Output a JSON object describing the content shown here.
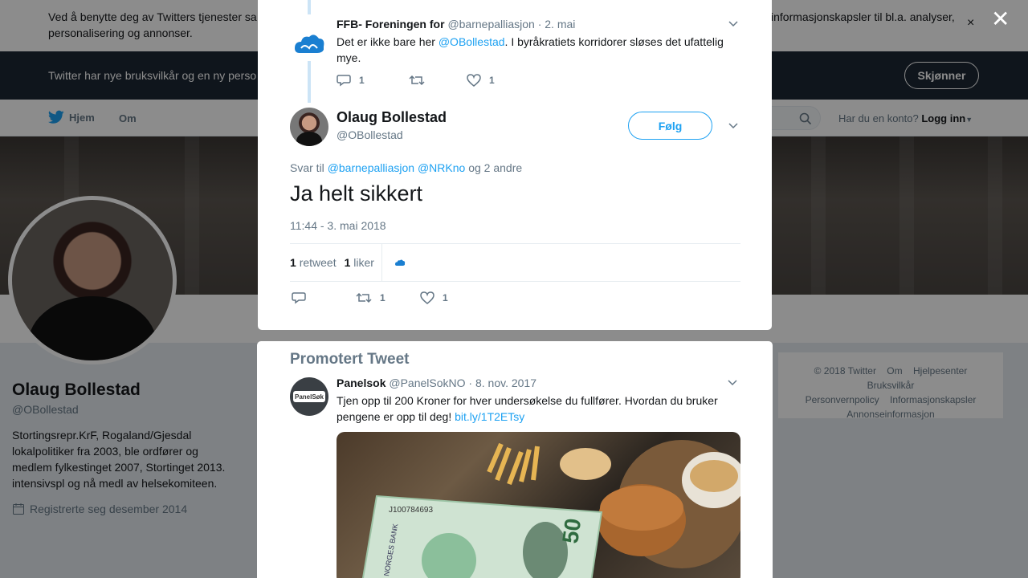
{
  "cookie_bar": {
    "text": "Ved å benytte deg av Twitters tjenester samtykker du i bruken av informasjonskapsler. Twitter og partnere bruker informasjonskapsler til bl.a. analyser, personalisering og annonser.",
    "text_visible_left": "Ved å benytte deg av Twitters tjenester sa",
    "text_visible_right": "informasjonskapsler til bl.a. analyser,",
    "text_line2": "personalisering og annonser.",
    "close": "×"
  },
  "terms_bar": {
    "text": "Twitter har nye bruksvilkår og en ny person",
    "button": "Skjønner"
  },
  "nav": {
    "home": "Hjem",
    "about": "Om",
    "account_prompt": "Har du en konto?",
    "login": "Logg inn"
  },
  "profile": {
    "name": "Olaug Bollestad",
    "handle": "@OBollestad",
    "bio": "Stortingsrepr.KrF, Rogaland/Gjesdal lokalpolitiker fra 2003, ble ordfører og medlem fylkestinget 2007, Stortinget 2013. intensivspl og nå medl av helsekomiteen.",
    "joined": "Registrerte seg desember 2014"
  },
  "footer": {
    "links": [
      "© 2018 Twitter",
      "Om",
      "Hjelpesenter",
      "Bruksvilkår",
      "Personvernpolicy",
      "Informasjonskapsler",
      "Annonseinformasjon"
    ]
  },
  "modal_close": "✕",
  "reply_tweet": {
    "name": "FFB- Foreningen for",
    "handle": "@barnepalliasjon",
    "date": "· 2. mai",
    "text_before": "Det er ikke bare her ",
    "mention": "@OBollestad",
    "text_after": ". I byråkratiets korridorer sløses det ufattelig mye.",
    "replies": "1",
    "retweets": "",
    "likes": "1"
  },
  "main_tweet": {
    "name": "Olaug Bollestad",
    "handle": "@OBollestad",
    "follow": "Følg",
    "reply_prefix": "Svar til",
    "reply_mention1": "@barnepalliasjon",
    "reply_mention2": "@NRKno",
    "reply_suffix": "og 2 andre",
    "text": "Ja helt sikkert",
    "timestamp": "11:44 - 3. mai 2018",
    "retweet_count": "1",
    "retweet_label": "retweet",
    "like_count": "1",
    "like_label": "liker",
    "action_retweets": "1",
    "action_likes": "1"
  },
  "promoted": {
    "title": "Promotert Tweet",
    "name": "Panelsok",
    "handle": "@PanelSokNO",
    "date": "· 8. nov. 2017",
    "text": "Tjen opp til 200 Kroner for hver undersøkelse du fullfører. Hvordan du bruker pengene er opp til deg! ",
    "link": "bit.ly/1T2ETsy",
    "avatar_logo": "PanelSøk",
    "image_banknote_serial": "J100784693",
    "image_banknote_bank": "NORGES BANK",
    "image_banknote_value": "50"
  },
  "colors": {
    "accent": "#1da1f2",
    "muted": "#657786",
    "dark_bar": "#1c2733",
    "like": "#657786"
  }
}
